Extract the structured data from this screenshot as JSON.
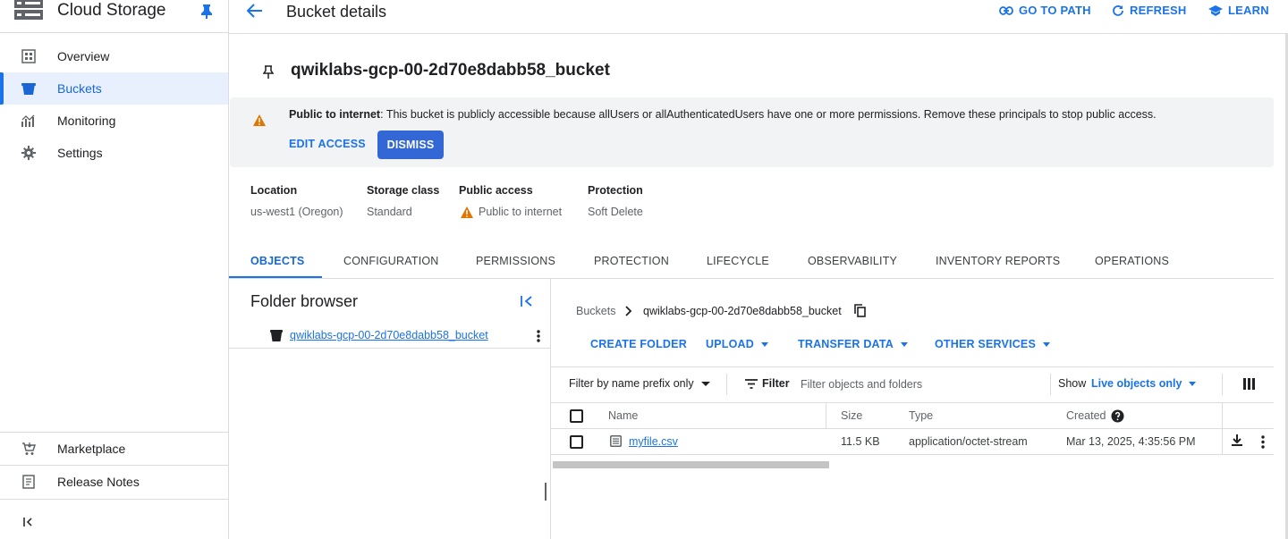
{
  "app": {
    "product_title": "Cloud Storage",
    "icons": {
      "product": "storage-icon",
      "pin": "pin-icon"
    }
  },
  "sidebar": {
    "items": [
      {
        "label": "Overview",
        "icon": "overview-icon",
        "active": false
      },
      {
        "label": "Buckets",
        "icon": "bucket-icon",
        "active": true
      },
      {
        "label": "Monitoring",
        "icon": "monitoring-icon",
        "active": false
      },
      {
        "label": "Settings",
        "icon": "gear-icon",
        "active": false
      }
    ],
    "bottom_items": [
      {
        "label": "Marketplace",
        "icon": "cart-icon"
      },
      {
        "label": "Release Notes",
        "icon": "notes-icon"
      }
    ],
    "collapse_icon": "collapse-sidebar-icon"
  },
  "header": {
    "title": "Bucket details",
    "actions": {
      "go_to_path": "GO TO PATH",
      "refresh": "REFRESH",
      "learn": "LEARN"
    }
  },
  "bucket": {
    "name": "qwiklabs-gcp-00-2d70e8dabb58_bucket"
  },
  "banner": {
    "title": "Public to internet",
    "message": ": This bucket is publicly accessible because allUsers or allAuthenticatedUsers have one or more permissions. Remove these principals to stop public access.",
    "edit_access": "EDIT ACCESS",
    "dismiss": "DISMISS",
    "accent": "#e37400"
  },
  "info": {
    "location_label": "Location",
    "location_value": "us-west1 (Oregon)",
    "storage_class_label": "Storage class",
    "storage_class_value": "Standard",
    "public_access_label": "Public access",
    "public_access_value": "Public to internet",
    "protection_label": "Protection",
    "protection_value": "Soft Delete"
  },
  "tabs": {
    "objects": "OBJECTS",
    "configuration": "CONFIGURATION",
    "permissions": "PERMISSIONS",
    "protection": "PROTECTION",
    "lifecycle": "LIFECYCLE",
    "observability": "OBSERVABILITY",
    "inventory_reports": "INVENTORY REPORTS",
    "operations": "OPERATIONS",
    "active": "OBJECTS"
  },
  "folder_browser": {
    "title": "Folder browser",
    "bucket": "qwiklabs-gcp-00-2d70e8dabb58_bucket"
  },
  "breadcrumb": {
    "root": "Buckets",
    "current": "qwiklabs-gcp-00-2d70e8dabb58_bucket"
  },
  "object_actions": {
    "create_folder": "CREATE FOLDER",
    "upload": "UPLOAD",
    "transfer_data": "TRANSFER DATA",
    "other_services": "OTHER SERVICES"
  },
  "filter": {
    "mode": "Filter by name prefix only",
    "label": "Filter",
    "placeholder": "Filter objects and folders",
    "show_label": "Show",
    "show_value": "Live objects only"
  },
  "table": {
    "columns": {
      "name": "Name",
      "size": "Size",
      "type": "Type",
      "created": "Created"
    },
    "rows": [
      {
        "name": "myfile.csv",
        "size": "11.5 KB",
        "type": "application/octet-stream",
        "created": "Mar 13, 2025, 4:35:56 PM"
      }
    ]
  },
  "colors": {
    "primary": "#1a73e8",
    "primary_button": "#3367d6",
    "warning": "#e37400"
  }
}
